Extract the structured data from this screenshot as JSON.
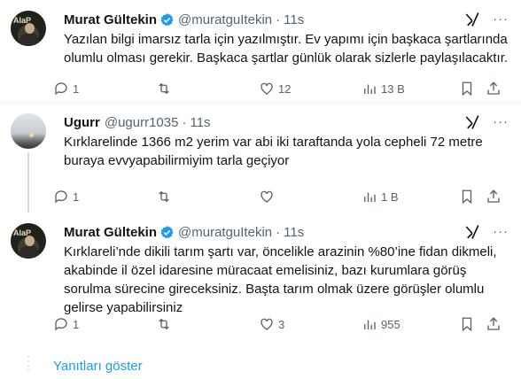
{
  "tweets": [
    {
      "name": "Murat Gültekin",
      "handle": "@muratguItekin",
      "time": "11s",
      "verified": true,
      "text": "Yazılan bilgi imarsız tarla için yazılmıştır. Ev yapımı için başkaca şartlarında olumlu olması gerekir. Başkaca şartlar günlük olarak sizlerle paylaşılacaktır.",
      "replies": "1",
      "retweets": "",
      "likes": "12",
      "views": "13 B"
    },
    {
      "name": "Ugurr",
      "handle": "@ugurr1035",
      "time": "11s",
      "verified": false,
      "text": "Kırklarelinde 1366 m2 yerim var abi iki taraftanda yola cepheli 72 metre buraya evvyapabilirmiyim tarla geçiyor",
      "replies": "1",
      "retweets": "",
      "likes": "",
      "views": "1 B"
    },
    {
      "name": "Murat Gültekin",
      "handle": "@muratguItekin",
      "time": "11s",
      "verified": true,
      "text": "Kırklareli’nde dikili tarım şartı var, öncelikle arazinin %80’ine fidan dikmeli, akabinde il özel idaresine müracaat emelisiniz, bazı kurumlara görüş sorulma sürecine gireceksiniz. Başta tarım olmak üzere görüşler olumlu gelirse yapabilirsiniz",
      "replies": "1",
      "retweets": "",
      "likes": "3",
      "views": "955"
    }
  ],
  "avatar_tag": "AlaP",
  "show_replies": "Yanıtları göster",
  "separator": "·",
  "icons": [
    "verified-badge-icon",
    "grok-icon",
    "more-icon",
    "reply-icon",
    "retweet-icon",
    "like-icon",
    "views-icon",
    "bookmark-icon",
    "share-icon"
  ],
  "colors": {
    "accent": "#1d9bf0",
    "muted": "#536471",
    "divider": "#eff3f4"
  }
}
